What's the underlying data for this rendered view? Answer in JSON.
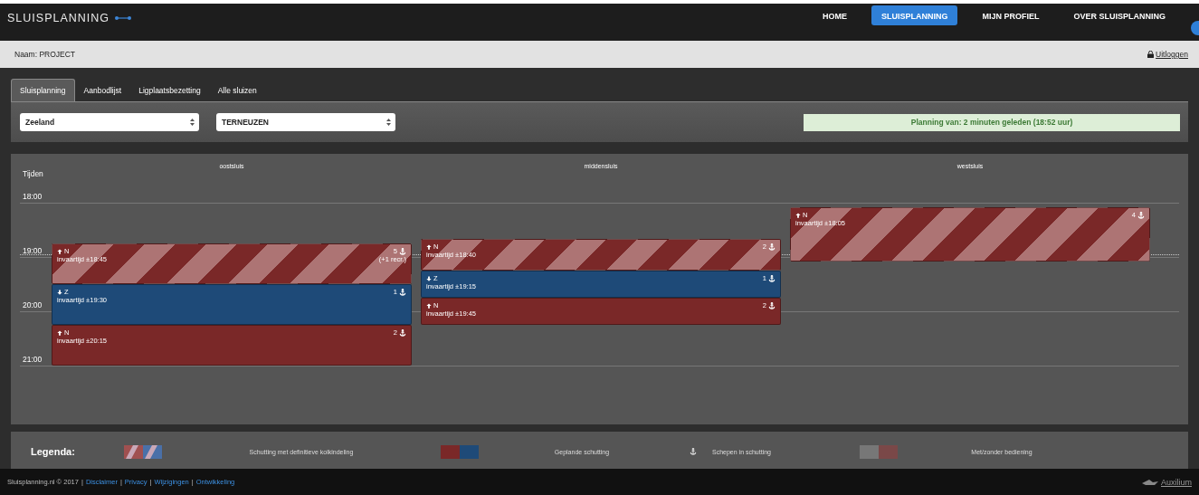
{
  "navbar": {
    "brand": "SLUISPLANNING",
    "menu": [
      {
        "label": "HOME",
        "selected": false
      },
      {
        "label": "SLUISPLANNING",
        "selected": true
      },
      {
        "label": "MIJN PROFIEL",
        "selected": false
      },
      {
        "label": "OVER SLUISPLANNING",
        "selected": false
      }
    ]
  },
  "userbar": {
    "name": "Naam: PROJECT",
    "logout": "Uitloggen"
  },
  "tabs": [
    {
      "label": "Sluisplanning",
      "selected": true
    },
    {
      "label": "Aanbodlijst",
      "selected": false
    },
    {
      "label": "Ligplaatsbezetting",
      "selected": false
    },
    {
      "label": "Alle sluizen",
      "selected": false
    }
  ],
  "filters": [
    {
      "value": "Zeeland"
    },
    {
      "value": "TERNEUZEN"
    }
  ],
  "status": "Planning van: 2 minuten geleden (18:52 uur)",
  "schedule": {
    "time_heading": "Tijden",
    "times": [
      "18:00",
      "19:00",
      "20:00",
      "21:00"
    ],
    "locks": [
      {
        "name": "oostsluis",
        "blocks": [
          {
            "kind": "striped",
            "upward": true,
            "heading": "N",
            "arrival": "invaartijd ±18:45",
            "count": "5",
            "note": "(+1 recr.)",
            "color": "#7a2828"
          },
          {
            "kind": "solid",
            "upward": false,
            "heading": "Z",
            "arrival": "invaartijd ±19:30",
            "count": "1",
            "color": "#1e4a78"
          },
          {
            "kind": "solid",
            "upward": true,
            "heading": "N",
            "arrival": "invaartijd ±20:15",
            "count": "2",
            "color": "#7a2828"
          }
        ]
      },
      {
        "name": "middensluis",
        "blocks": [
          {
            "kind": "striped",
            "upward": true,
            "heading": "N",
            "arrival": "invaartijd ±18:40",
            "count": "2",
            "color": "#7a2828"
          },
          {
            "kind": "solid",
            "upward": false,
            "heading": "Z",
            "arrival": "invaartijd ±19:15",
            "count": "1",
            "color": "#1e4a78"
          },
          {
            "kind": "solid",
            "upward": true,
            "heading": "N",
            "arrival": "invaartijd ±19:45",
            "count": "2",
            "color": "#7a2828"
          }
        ]
      },
      {
        "name": "westsluis",
        "blocks": [
          {
            "kind": "striped",
            "upward": true,
            "heading": "N",
            "arrival": "invaartijd ±18:05",
            "count": "4",
            "color": "#7a2828"
          }
        ]
      }
    ]
  },
  "legend": {
    "title": "Legenda:",
    "items": [
      {
        "kind": "striped",
        "label": "Schutting met definitieve kolkindeling"
      },
      {
        "kind": "planned",
        "label": "Geplande schutting"
      },
      {
        "kind": "anchor",
        "label": "Schepen in schutting"
      },
      {
        "kind": "service",
        "label": "Met/zonder bediening"
      }
    ]
  },
  "footer": {
    "copyright": "Sluisplanning.nl © 2017",
    "separator": "|",
    "links": [
      "Disclaimer",
      "Privacy",
      "Wijzigingen",
      "Ontwikkeling"
    ],
    "logo": "Auxilium"
  }
}
